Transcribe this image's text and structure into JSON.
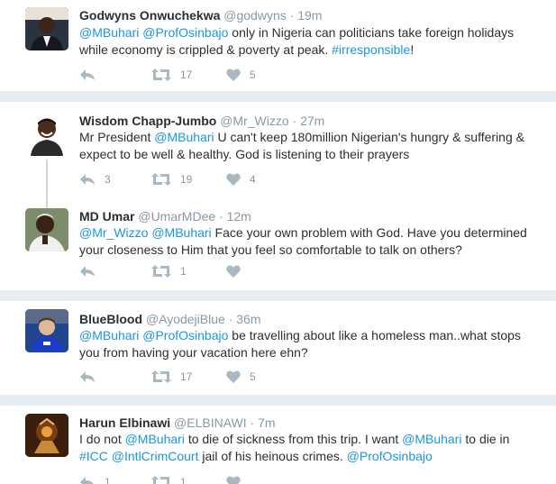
{
  "tweets": [
    {
      "name": "Godwyns Onwuchekwa",
      "handle": "@godwyns",
      "time": "19m",
      "segments": [
        {
          "t": "@MBuhari",
          "m": true
        },
        {
          "t": " "
        },
        {
          "t": "@ProfOsinbajo",
          "m": true
        },
        {
          "t": " only in Nigeria can  politicians take foreign holidays while economy is crippled & poverty at peak. "
        },
        {
          "t": "#irresponsible",
          "m": true
        },
        {
          "t": "!"
        }
      ],
      "replies": "",
      "retweets": "17",
      "likes": "5"
    },
    {
      "name": "Wisdom Chapp-Jumbo",
      "handle": "@Mr_Wizzo",
      "time": "27m",
      "segments": [
        {
          "t": "Mr President "
        },
        {
          "t": "@MBuhari",
          "m": true
        },
        {
          "t": " U can't keep 180million Nigerian's hungry & suffering & expect to be well & healthy. God is listening to their prayers"
        }
      ],
      "replies": "3",
      "retweets": "19",
      "likes": "4"
    },
    {
      "name": "MD Umar",
      "handle": "@UmarMDee",
      "time": "12m",
      "segments": [
        {
          "t": "@Mr_Wizzo",
          "m": true
        },
        {
          "t": " "
        },
        {
          "t": "@MBuhari",
          "m": true
        },
        {
          "t": " Face your own problem with God. Have you determined your closeness to Him that you feel so comfortable to talk on others?"
        }
      ],
      "replies": "",
      "retweets": "1",
      "likes": ""
    },
    {
      "name": "BlueBlood",
      "handle": "@AyodejiBlue",
      "time": "36m",
      "segments": [
        {
          "t": "@MBuhari",
          "m": true
        },
        {
          "t": " "
        },
        {
          "t": "@ProfOsinbajo",
          "m": true
        },
        {
          "t": " be travelling about like a homeless man..what stops you from having your vacation here ehn?"
        }
      ],
      "replies": "",
      "retweets": "17",
      "likes": "5"
    },
    {
      "name": "Harun Elbinawi",
      "handle": "@ELBINAWI",
      "time": "7m",
      "segments": [
        {
          "t": "I do not "
        },
        {
          "t": "@MBuhari",
          "m": true
        },
        {
          "t": " to die of sickness from this trip. I want "
        },
        {
          "t": "@MBuhari",
          "m": true
        },
        {
          "t": " to die in "
        },
        {
          "t": "#ICC",
          "m": true
        },
        {
          "t": " "
        },
        {
          "t": "@IntlCrimCourt",
          "m": true
        },
        {
          "t": " jail of his heinous crimes. "
        },
        {
          "t": "@ProfOsinbajo",
          "m": true
        }
      ],
      "replies": "1",
      "retweets": "1",
      "likes": ""
    }
  ],
  "ui": {
    "dot": "·",
    "colors": {
      "link": "#1b95e0",
      "muted": "#8899a6",
      "icon": "#aab8c2",
      "bg": "#e6ecf0"
    },
    "icons": [
      "reply-icon",
      "retweet-icon",
      "like-icon"
    ]
  }
}
